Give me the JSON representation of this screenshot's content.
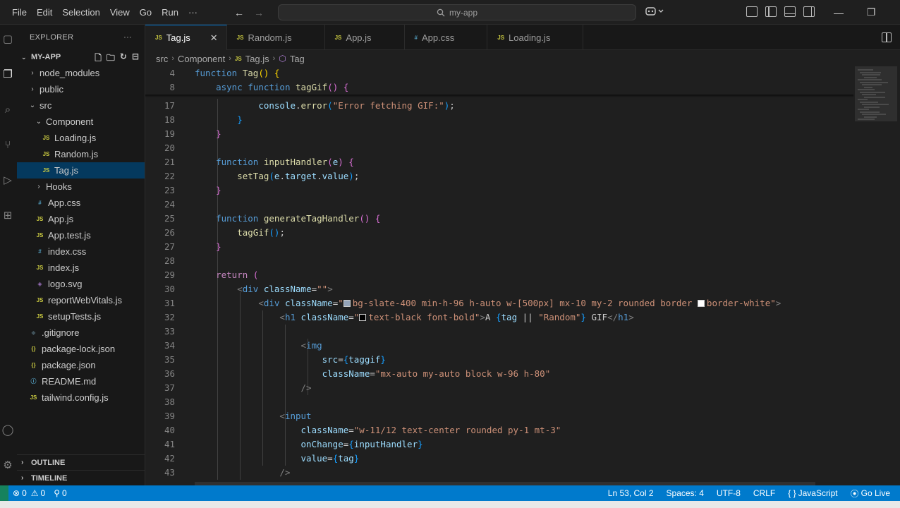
{
  "menu": [
    "File",
    "Edit",
    "Selection",
    "View",
    "Go",
    "Run",
    "···"
  ],
  "nav": {
    "back": "←",
    "forward": "→"
  },
  "command_center": {
    "label": "my-app"
  },
  "window_controls": {
    "minimize": "—",
    "restore": "❐"
  },
  "sidebar": {
    "header": "EXPLORER",
    "more": "···",
    "root": "MY-APP",
    "items": [
      {
        "label": "node_modules",
        "kind": "folder",
        "depth": 1
      },
      {
        "label": "public",
        "kind": "folder",
        "depth": 1
      },
      {
        "label": "src",
        "kind": "folder-open",
        "depth": 1
      },
      {
        "label": "Component",
        "kind": "folder-open",
        "depth": 2
      },
      {
        "label": "Loading.js",
        "kind": "js",
        "depth": 3
      },
      {
        "label": "Random.js",
        "kind": "js",
        "depth": 3
      },
      {
        "label": "Tag.js",
        "kind": "js",
        "depth": 3,
        "selected": true
      },
      {
        "label": "Hooks",
        "kind": "folder",
        "depth": 2
      },
      {
        "label": "App.css",
        "kind": "css",
        "depth": 2
      },
      {
        "label": "App.js",
        "kind": "js",
        "depth": 2
      },
      {
        "label": "App.test.js",
        "kind": "js",
        "depth": 2
      },
      {
        "label": "index.css",
        "kind": "css",
        "depth": 2
      },
      {
        "label": "index.js",
        "kind": "js",
        "depth": 2
      },
      {
        "label": "logo.svg",
        "kind": "svg",
        "depth": 2
      },
      {
        "label": "reportWebVitals.js",
        "kind": "js",
        "depth": 2
      },
      {
        "label": "setupTests.js",
        "kind": "js",
        "depth": 2
      },
      {
        "label": ".gitignore",
        "kind": "git",
        "depth": 1
      },
      {
        "label": "package-lock.json",
        "kind": "json",
        "depth": 1
      },
      {
        "label": "package.json",
        "kind": "json",
        "depth": 1
      },
      {
        "label": "README.md",
        "kind": "md",
        "depth": 1
      },
      {
        "label": "tailwind.config.js",
        "kind": "js",
        "depth": 1
      }
    ],
    "outline": "OUTLINE",
    "timeline": "TIMELINE"
  },
  "icons": {
    "js": "JS",
    "css": "#",
    "svg": "◈",
    "json": "{}",
    "md": "ⓘ",
    "git": "◆",
    "folder": "›",
    "folder-open": "⌄"
  },
  "tabs": [
    {
      "label": "Tag.js",
      "active": true,
      "icon": "JS"
    },
    {
      "label": "Random.js",
      "active": false,
      "icon": "JS"
    },
    {
      "label": "App.js",
      "active": false,
      "icon": "JS"
    },
    {
      "label": "App.css",
      "active": false,
      "icon": "#"
    },
    {
      "label": "Loading.js",
      "active": false,
      "icon": "JS"
    }
  ],
  "breadcrumb": {
    "folder1": "src",
    "folder2": "Component",
    "file": "Tag.js",
    "symbol": "Tag"
  },
  "code": [
    {
      "n": "4",
      "sticky": true,
      "html": "<span class='k'>function</span> <span class='f'>Tag</span><span class='b'>()</span> <span class='b'>{</span>"
    },
    {
      "n": "8",
      "sticky": true,
      "html": "    <span class='k'>async</span> <span class='k'>function</span> <span class='f'>tagGif</span><span class='b2'>()</span> <span class='b2'>{</span>"
    },
    {
      "n": "17",
      "html": "            <span class='v'>console</span>.<span class='f'>error</span><span class='b3'>(</span><span class='s'>\"Error fetching GIF:\"</span><span class='b3'>)</span>;"
    },
    {
      "n": "18",
      "html": "        <span class='b3'>}</span>"
    },
    {
      "n": "19",
      "html": "    <span class='b2'>}</span>"
    },
    {
      "n": "20",
      "html": ""
    },
    {
      "n": "21",
      "html": "    <span class='k'>function</span> <span class='f'>inputHandler</span><span class='b2'>(</span><span class='v'>e</span><span class='b2'>)</span> <span class='b2'>{</span>"
    },
    {
      "n": "22",
      "html": "        <span class='f'>setTag</span><span class='b3'>(</span><span class='v'>e</span>.<span class='v'>target</span>.<span class='v'>value</span><span class='b3'>)</span>;"
    },
    {
      "n": "23",
      "html": "    <span class='b2'>}</span>"
    },
    {
      "n": "24",
      "html": ""
    },
    {
      "n": "25",
      "html": "    <span class='k'>function</span> <span class='f'>generateTagHandler</span><span class='b2'>()</span> <span class='b2'>{</span>"
    },
    {
      "n": "26",
      "html": "        <span class='f'>tagGif</span><span class='b3'>()</span>;"
    },
    {
      "n": "27",
      "html": "    <span class='b2'>}</span>"
    },
    {
      "n": "28",
      "html": ""
    },
    {
      "n": "29",
      "html": "    <span class='kc'>return</span> <span class='b2'>(</span>"
    },
    {
      "n": "30",
      "html": "        <span class='tg'>&lt;</span><span class='t'>div</span> <span class='a'>className</span>=<span class='s'>\"\"</span><span class='tg'>&gt;</span>"
    },
    {
      "n": "31",
      "html": "            <span class='tg'>&lt;</span><span class='t'>div</span> <span class='a'>className</span>=<span class='s'>\"<span class='swatch' style='background:#94a3b8'></span>bg-slate-400 min-h-96 h-auto w-[500px] mx-10 my-2 rounded border <span class='swatch' style='background:#ffffff'></span>border-white\"</span><span class='tg'>&gt;</span>"
    },
    {
      "n": "32",
      "html": "                <span class='tg'>&lt;</span><span class='t'>h1</span> <span class='a'>className</span>=<span class='s'>\"<span class='swatch' style='background:#000000'></span>text-black font-bold\"</span><span class='tg'>&gt;</span>A <span class='b3'>{</span><span class='v'>tag</span> || <span class='s'>\"Random\"</span><span class='b3'>}</span> GIF<span class='tg'>&lt;/</span><span class='t'>h1</span><span class='tg'>&gt;</span>"
    },
    {
      "n": "33",
      "html": ""
    },
    {
      "n": "34",
      "html": "                    <span class='tg'>&lt;</span><span class='t'>img</span>"
    },
    {
      "n": "35",
      "html": "                        <span class='a'>src</span>=<span class='b3'>{</span><span class='v'>taggif</span><span class='b3'>}</span>"
    },
    {
      "n": "36",
      "html": "                        <span class='a'>className</span>=<span class='s'>\"mx-auto my-auto block w-96 h-80\"</span>"
    },
    {
      "n": "37",
      "html": "                    <span class='tg'>/&gt;</span>"
    },
    {
      "n": "38",
      "html": ""
    },
    {
      "n": "39",
      "html": "                <span class='tg'>&lt;</span><span class='t'>input</span>"
    },
    {
      "n": "40",
      "html": "                    <span class='a'>className</span>=<span class='s'>\"w-11/12 text-center rounded py-1 mt-3\"</span>"
    },
    {
      "n": "41",
      "html": "                    <span class='a'>onChange</span>=<span class='b3'>{</span><span class='v'>inputHandler</span><span class='b3'>}</span>"
    },
    {
      "n": "42",
      "html": "                    <span class='a'>value</span>=<span class='b3'>{</span><span class='v'>tag</span><span class='b3'>}</span>"
    },
    {
      "n": "43",
      "html": "                <span class='tg'>/&gt;</span>"
    }
  ],
  "status": {
    "errors": "0",
    "warnings": "0",
    "ports": "0",
    "position": "Ln 53, Col 2",
    "spaces": "Spaces: 4",
    "encoding": "UTF-8",
    "eol": "CRLF",
    "language": "JavaScript",
    "golive": "Go Live"
  }
}
